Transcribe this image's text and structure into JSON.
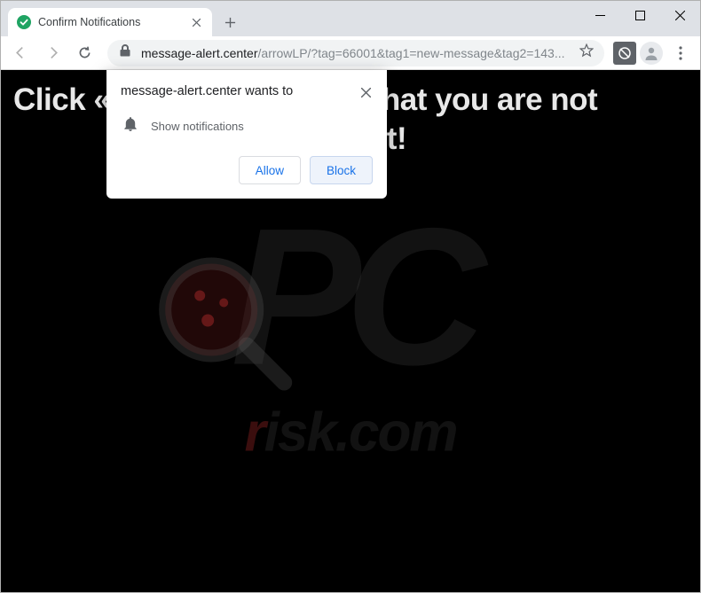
{
  "window": {
    "minimize": "–",
    "maximize": "◻",
    "close": "✕"
  },
  "tab": {
    "title": "Confirm Notifications"
  },
  "url": {
    "host": "message-alert.center",
    "path": "/arrowLP/?tag=66001&tag1=new-message&tag2=143..."
  },
  "page": {
    "headline_line1": "Click «Allow» to confirm that you are not",
    "headline_line2": "a robot!"
  },
  "permission": {
    "title": "message-alert.center wants to",
    "item": "Show notifications",
    "allow": "Allow",
    "block": "Block"
  },
  "watermark": {
    "pc": "PC",
    "domain_r": "r",
    "domain_rest": "isk.com"
  }
}
